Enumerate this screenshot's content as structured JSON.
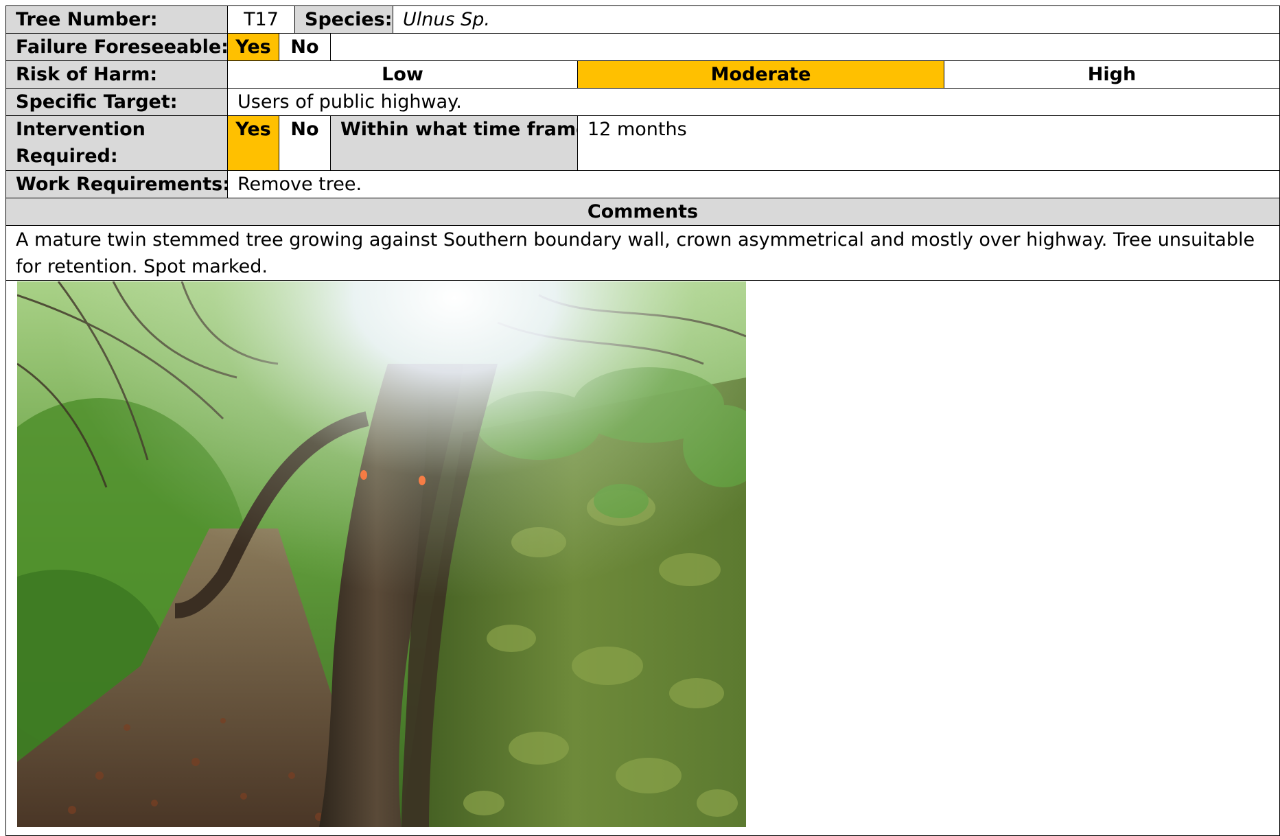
{
  "labels": {
    "tree_number": "Tree Number:",
    "species": "Species:",
    "failure_foreseeable": "Failure Foreseeable:",
    "risk_of_harm": "Risk of Harm:",
    "specific_target": "Specific Target:",
    "intervention_required": "Intervention Required:",
    "within_time_frame": "Within what time frame:",
    "work_requirements": "Work Requirements:",
    "comments": "Comments"
  },
  "values": {
    "tree_number": "T17",
    "species": "Ulnus Sp.",
    "specific_target": "Users of public highway.",
    "time_frame": "12 months",
    "work_requirements": "Remove tree.",
    "comments": "A mature twin stemmed tree growing against Southern boundary wall, crown asymmetrical and mostly over highway. Tree unsuitable for retention. Spot marked."
  },
  "options": {
    "failure_foreseeable": [
      "Yes",
      "No"
    ],
    "failure_foreseeable_selected": "Yes",
    "risk_of_harm": [
      "Low",
      "Moderate",
      "High"
    ],
    "risk_of_harm_selected": "Moderate",
    "intervention_required": [
      "Yes",
      "No"
    ],
    "intervention_required_selected": "Yes"
  },
  "colors": {
    "label_background": "#d9d9d9",
    "selected_highlight": "#ffc000",
    "border": "#000000"
  }
}
